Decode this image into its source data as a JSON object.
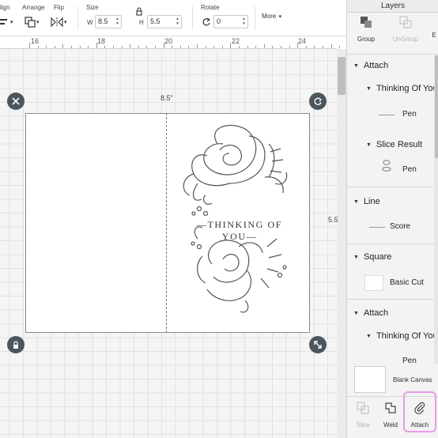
{
  "toolbar": {
    "align_label": "lign",
    "arrange_label": "Arrange",
    "flip_label": "Flip",
    "size_label": "Size",
    "width_label": "W",
    "width_value": "8.5",
    "height_label": "H",
    "height_value": "5.5",
    "rotate_label": "Rotate",
    "rotate_value": "0",
    "more_label": "More"
  },
  "ruler": {
    "marks": [
      "16",
      "18",
      "20",
      "22",
      "24"
    ]
  },
  "canvas": {
    "width_dimension": "8.5\"",
    "height_dimension": "5.5",
    "card_text": "—THINKING OF YOU—"
  },
  "layers_panel": {
    "title": "Layers",
    "group_label": "Group",
    "ungroup_label": "UnGroup",
    "edge_label": "E",
    "items": [
      {
        "label": "Attach"
      },
      {
        "label": "Thinking Of You"
      },
      {
        "label": "Pen"
      },
      {
        "label": "Slice Result"
      },
      {
        "label": "Pen"
      },
      {
        "label": "Line"
      },
      {
        "label": "Score"
      },
      {
        "label": "Square"
      },
      {
        "label": "Basic Cut"
      },
      {
        "label": "Attach"
      },
      {
        "label": "Thinking Of You"
      },
      {
        "label": "Pen"
      }
    ],
    "blank_canvas_label": "Blank Canvas",
    "slice_label": "Slice",
    "weld_label": "Weld",
    "attach_label": "Attach"
  },
  "colors": {
    "handle": "#4b565d",
    "highlight": "#e99be6",
    "canvas_bg": "#f5f5f5"
  }
}
